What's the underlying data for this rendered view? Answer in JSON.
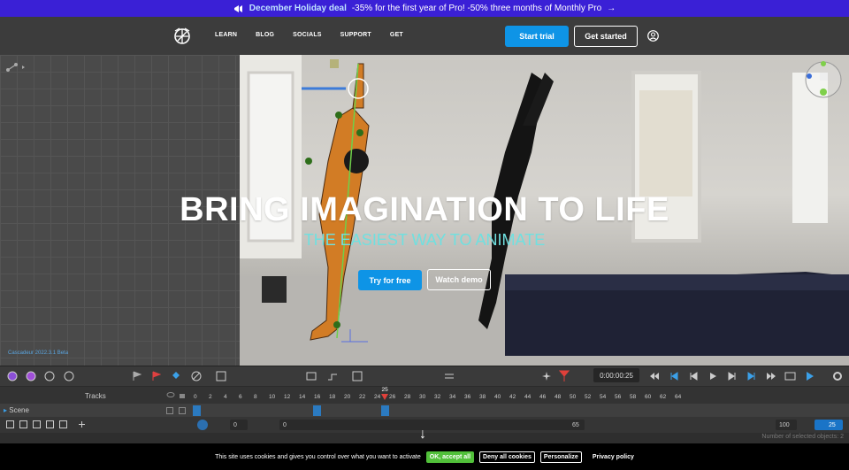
{
  "promo": {
    "icon": "megaphone-icon",
    "highlight": "December Holiday deal",
    "text": "-35% for the first year of Pro! -50% three months of Monthly Pro",
    "arrow": "→"
  },
  "nav": {
    "links": [
      "LEARN",
      "BLOG",
      "SOCIALS",
      "SUPPORT",
      "GET"
    ],
    "start_trial": "Start trial",
    "get_started": "Get started"
  },
  "left_panel": {
    "copyright": "Cascadeur 2022.3.1 Beta"
  },
  "hero": {
    "title": "BRING IMAGINATION TO LIFE",
    "subtitle": "THE EASIEST WAY TO ANIMATE",
    "try_free": "Try for free",
    "watch_demo": "Watch demo"
  },
  "timeline": {
    "timecode": "0:00:00:25",
    "tracks_label": "Tracks",
    "scene_label": "Scene",
    "ruler_ticks": [
      "0",
      "2",
      "4",
      "6",
      "8",
      "10",
      "12",
      "14",
      "16",
      "18",
      "20",
      "22",
      "24",
      "26",
      "28",
      "30",
      "32",
      "34",
      "36",
      "38",
      "40",
      "42",
      "44",
      "46",
      "48",
      "50",
      "52",
      "54",
      "56",
      "58",
      "60",
      "62",
      "64"
    ],
    "current_frame": "25",
    "interval_start": "0",
    "interval_start2": "0",
    "interval_end": "65",
    "total_frames": "100",
    "fps": "25",
    "status": "Number of selected objects: 2"
  },
  "cookie": {
    "text": "This site uses cookies and gives you control over what you want to activate",
    "ok": "OK, accept all",
    "deny": "Deny all cookies",
    "personalize": "Personalize",
    "privacy": "Privacy policy"
  },
  "colors": {
    "promo_bg": "#3a20d6",
    "accent_blue": "#0e94e6",
    "subtitle_cyan": "#6fe0e0",
    "cookie_ok_green": "#51c03a",
    "playhead_red": "#e0403a"
  }
}
